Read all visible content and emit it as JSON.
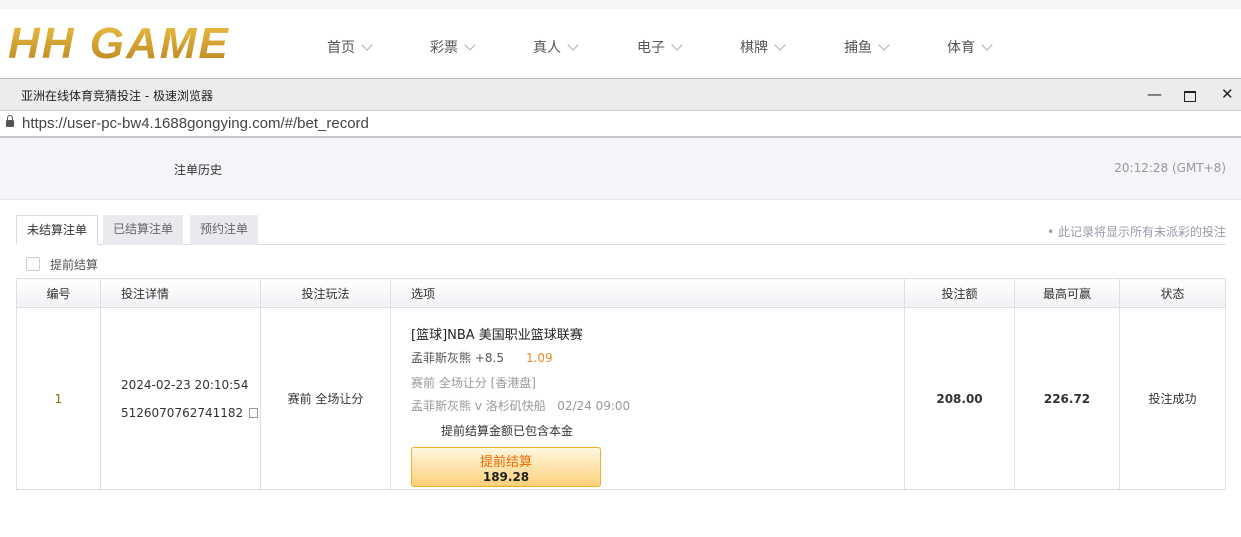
{
  "site": {
    "logo": "HH GAME",
    "nav": [
      "首页",
      "彩票",
      "真人",
      "电子",
      "棋牌",
      "捕鱼",
      "体育"
    ]
  },
  "window": {
    "title": "亚洲在线体育竞猜投注 - 极速浏览器",
    "url": "https://user-pc-bw4.1688gongying.com/#/bet_record"
  },
  "page": {
    "title": "注单历史",
    "time": "20:12:28 (GMT+8)"
  },
  "tabs": [
    "未结算注单",
    "已结算注单",
    "预约注单"
  ],
  "note": "此记录将显示所有未派彩的投注",
  "early_cashout_checkbox": "提前结算",
  "table": {
    "headers": [
      "编号",
      "投注详情",
      "投注玩法",
      "选项",
      "投注额",
      "最高可赢",
      "状态"
    ],
    "rows": [
      {
        "no": "1",
        "datetime": "2024-02-23 20:10:54",
        "order_id": "5126070762741182",
        "play": "赛前 全场让分",
        "league": "[篮球]NBA 美国职业篮球联赛",
        "selection": "孟菲斯灰熊 +8.5",
        "odds": "1.09",
        "market": "赛前   全场让分   [香港盘]",
        "match": "孟菲斯灰熊 v 洛杉矶快船",
        "match_time": "02/24 09:00",
        "cashout_note": "提前结算金额已包含本金",
        "cashout_label": "提前结算",
        "cashout_amount": "189.28",
        "stake": "208.00",
        "max_win": "226.72",
        "status": "投注成功"
      }
    ]
  }
}
